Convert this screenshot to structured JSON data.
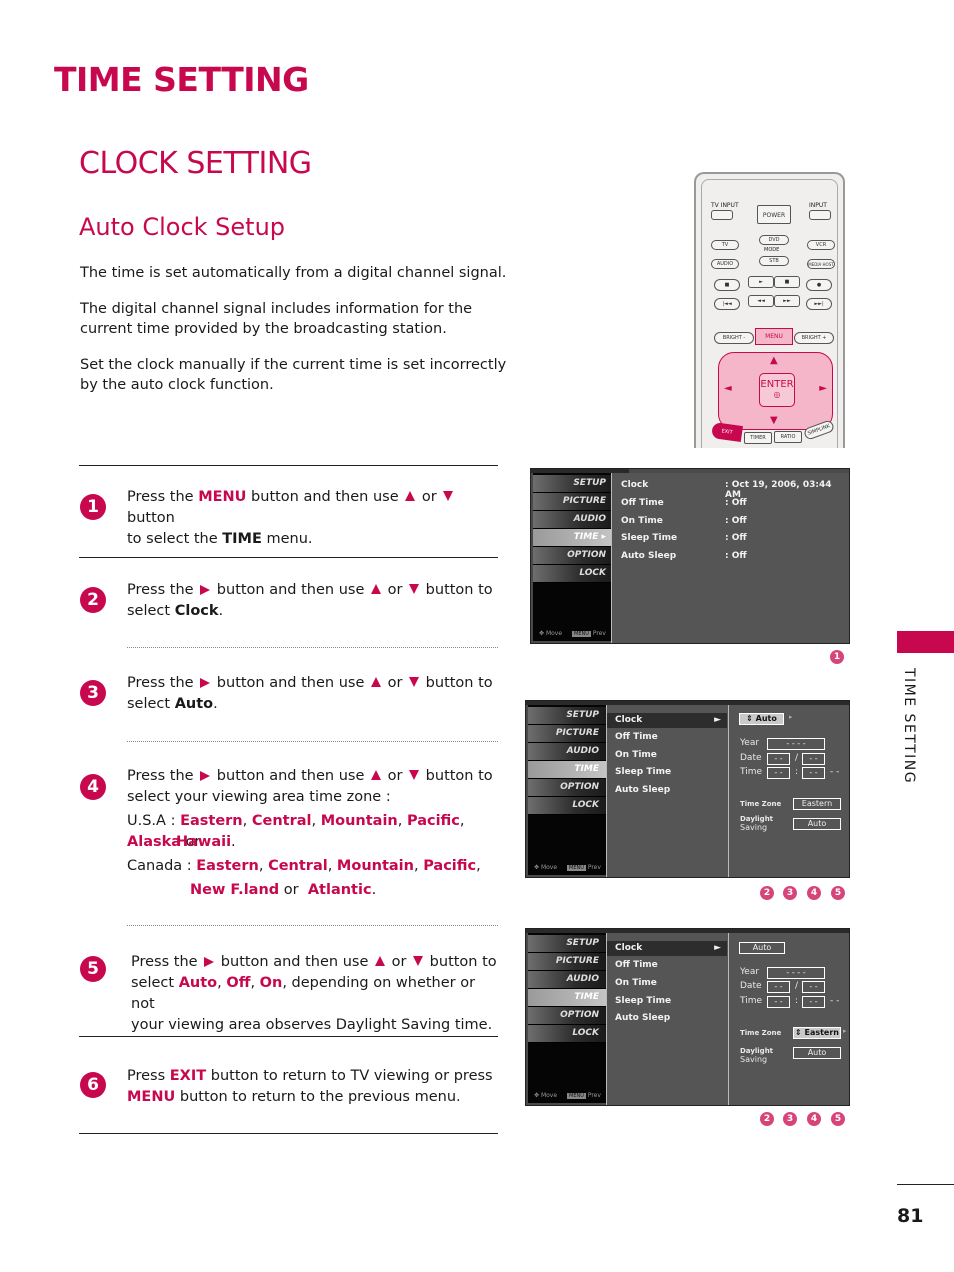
{
  "page": {
    "title": "TIME SETTING",
    "section_title": "CLOCK SETTING",
    "subsection_title": "Auto Clock Setup",
    "side_tab_label": "TIME SETTING",
    "page_number": "81",
    "accent_color": "#c8084e"
  },
  "intro": [
    "The time is set automatically from a digital channel signal.",
    "The digital channel signal includes information for the current time provided by the broadcasting station.",
    "Set the clock manually if the current time is set incorrectly by the auto clock function."
  ],
  "steps": [
    {
      "num": "1",
      "parts": [
        "Press the ",
        "MENU",
        " button and then use ",
        "▲",
        " or ",
        "▼",
        " button to select the ",
        "TIME",
        " menu."
      ]
    },
    {
      "num": "2",
      "parts": [
        "Press the ",
        "►",
        " button and then use ",
        "▲",
        " or ",
        "▼",
        " button to select ",
        "Clock",
        "."
      ]
    },
    {
      "num": "3",
      "parts": [
        "Press the ",
        "►",
        " button and then use ",
        "▲",
        " or ",
        "▼",
        " button to select ",
        "Auto",
        "."
      ]
    },
    {
      "num": "4",
      "line1": "button and then use",
      "line2": "select your viewing area time zone :",
      "usa_label": "U.S.A :",
      "usa_zones": [
        "Eastern",
        "Central",
        "Mountain",
        "Pacific",
        "Alaska",
        "Hawaii"
      ],
      "canada_label": "Canada :",
      "canada_zones": [
        "Eastern",
        "Central",
        "Mountain",
        "Pacific",
        "New F.land",
        "Atlantic"
      ],
      "or": "or"
    },
    {
      "num": "5",
      "options": [
        "Auto",
        "Off",
        "On"
      ],
      "tail": ", depending on whether or not",
      "line3": "your viewing area observes Daylight Saving time."
    },
    {
      "num": "6",
      "exit": "EXIT",
      "menu": "MENU",
      "text1": " button to return to TV viewing or press",
      "text2": " button to return to the previous menu.",
      "press": "Press "
    }
  ],
  "common": {
    "press_the": "Press the",
    "button_then_use": "button and then use",
    "or": "or",
    "button_to": "button to",
    "select": "select"
  },
  "remote": {
    "buttons": {
      "tv_input": "TV INPUT",
      "power": "POWER",
      "input": "INPUT",
      "tv": "TV",
      "dvd": "DVD",
      "vcr": "VCR",
      "mode": "MODE",
      "audio": "AUDIO",
      "stb": "STB",
      "media_host": "MEDIA HOST",
      "bright_minus": "BRIGHT -",
      "menu": "MENU",
      "bright_plus": "BRIGHT +",
      "enter": "ENTER",
      "exit": "EXIT",
      "timer": "TIMER",
      "ratio": "RATIO",
      "simplink": "SIMPLINK"
    }
  },
  "osd": {
    "left_menu": [
      "SETUP",
      "PICTURE",
      "AUDIO",
      "TIME",
      "OPTION",
      "LOCK"
    ],
    "selected": "TIME",
    "footer_move": "Move",
    "footer_menu": "MENU",
    "footer_prev": "Prev",
    "screen1": {
      "rows": [
        {
          "label": "Clock",
          "value": ": Oct 19, 2006, 03:44 AM"
        },
        {
          "label": "Off Time",
          "value": ": Off"
        },
        {
          "label": "On Time",
          "value": ": Off"
        },
        {
          "label": "Sleep Time",
          "value": ": Off"
        },
        {
          "label": "Auto Sleep",
          "value": ": Off"
        }
      ],
      "step_badges": [
        "1"
      ]
    },
    "screen2": {
      "items": [
        "Clock",
        "Off Time",
        "On Time",
        "Sleep Time",
        "Auto Sleep"
      ],
      "mode": "Auto",
      "year_label": "Year",
      "year_value": "- - - -",
      "date_label": "Date",
      "date_m": "- -",
      "date_sep": "/",
      "date_d": "- -",
      "time_label": "Time",
      "time_h": "- -",
      "time_sep": ":",
      "time_m": "- -",
      "time_ampm": "- -",
      "tz_label": "Time Zone",
      "tz_value": "Eastern",
      "ds_label1": "Daylight",
      "ds_label2": "Saving",
      "ds_value": "Auto",
      "step_badges": [
        "2",
        "3",
        "4",
        "5"
      ]
    },
    "screen3": {
      "items": [
        "Clock",
        "Off Time",
        "On Time",
        "Sleep Time",
        "Auto Sleep"
      ],
      "mode": "Auto",
      "year_label": "Year",
      "year_value": "- - - -",
      "date_label": "Date",
      "date_m": "- -",
      "date_sep": "/",
      "date_d": "- -",
      "time_label": "Time",
      "time_h": "- -",
      "time_sep": ":",
      "time_m": "- -",
      "time_ampm": "- -",
      "tz_label": "Time Zone",
      "tz_value": "Eastern",
      "ds_label1": "Daylight",
      "ds_label2": "Saving",
      "ds_value": "Auto",
      "step_badges": [
        "2",
        "3",
        "4",
        "5"
      ]
    }
  }
}
